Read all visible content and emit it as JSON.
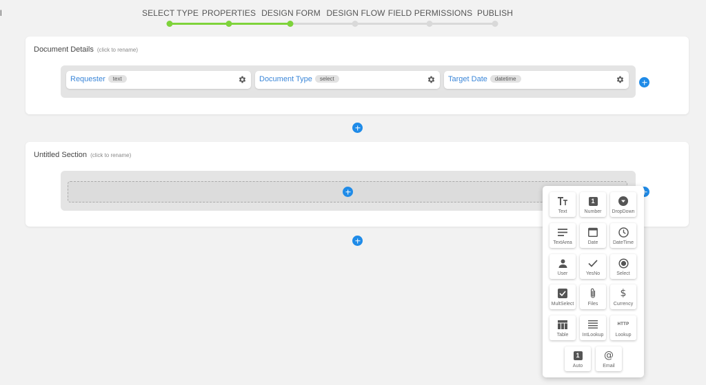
{
  "edge_char": "l",
  "stepper": {
    "steps": [
      {
        "label": "SELECT TYPE",
        "done": true
      },
      {
        "label": "PROPERTIES",
        "done": true
      },
      {
        "label": "DESIGN FORM",
        "done": true
      },
      {
        "label": "DESIGN FLOW",
        "done": false
      },
      {
        "label": "FIELD PERMISSIONS",
        "done": false
      },
      {
        "label": "PUBLISH",
        "done": false
      }
    ]
  },
  "colors": {
    "accent": "#1f8be8",
    "progress": "#7ed33b",
    "field_name": "#3a86d8"
  },
  "sections": [
    {
      "title": "Document Details",
      "hint": "(click to rename)",
      "fields": [
        {
          "name": "Requester",
          "type": "text"
        },
        {
          "name": "Document Type",
          "type": "select"
        },
        {
          "name": "Target Date",
          "type": "datetime"
        }
      ]
    },
    {
      "title": "Untitled Section",
      "hint": "(click to rename)",
      "fields": []
    }
  ],
  "palette": {
    "items": [
      {
        "label": "Text",
        "icon": "text-icon"
      },
      {
        "label": "Number",
        "icon": "number-icon"
      },
      {
        "label": "DropDown",
        "icon": "dropdown-icon"
      },
      {
        "label": "TextArea",
        "icon": "textarea-icon"
      },
      {
        "label": "Date",
        "icon": "calendar-icon"
      },
      {
        "label": "DateTime",
        "icon": "clock-icon"
      },
      {
        "label": "User",
        "icon": "user-icon"
      },
      {
        "label": "YesNo",
        "icon": "check-icon"
      },
      {
        "label": "Select",
        "icon": "radio-icon"
      },
      {
        "label": "MultSelect",
        "icon": "checkbox-icon"
      },
      {
        "label": "Files",
        "icon": "paperclip-icon"
      },
      {
        "label": "Currency",
        "icon": "dollar-icon"
      },
      {
        "label": "Table",
        "icon": "table-icon"
      },
      {
        "label": "IntLookup",
        "icon": "list-icon"
      },
      {
        "label": "Lookup",
        "icon": "http-icon"
      },
      {
        "label": "Auto",
        "icon": "auto-number-icon"
      },
      {
        "label": "Email",
        "icon": "at-icon"
      }
    ],
    "http_text": "HTTP",
    "number_glyph": "1",
    "auto_glyph": "1"
  }
}
